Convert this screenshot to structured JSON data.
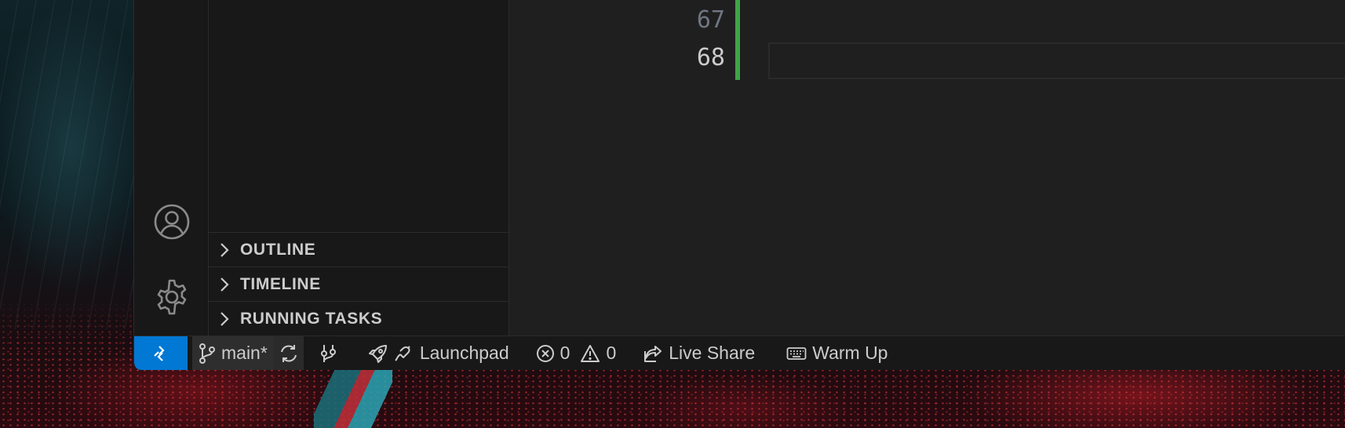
{
  "editor": {
    "line_numbers": [
      "67",
      "68"
    ]
  },
  "sidebar": {
    "sections": [
      {
        "label": "OUTLINE"
      },
      {
        "label": "TIMELINE"
      },
      {
        "label": "RUNNING TASKS"
      }
    ]
  },
  "activity_bar": {
    "icons": [
      "account-icon",
      "settings-gear-icon"
    ]
  },
  "statusbar": {
    "branch": "main*",
    "launchpad": "Launchpad",
    "errors": "0",
    "warnings": "0",
    "live_share": "Live Share",
    "warm_up": "Warm Up"
  },
  "colors": {
    "accent": "#0078d4",
    "gutter_added": "#3fa345",
    "editor_bg": "#1f1f1f",
    "sidebar_bg": "#181818"
  }
}
